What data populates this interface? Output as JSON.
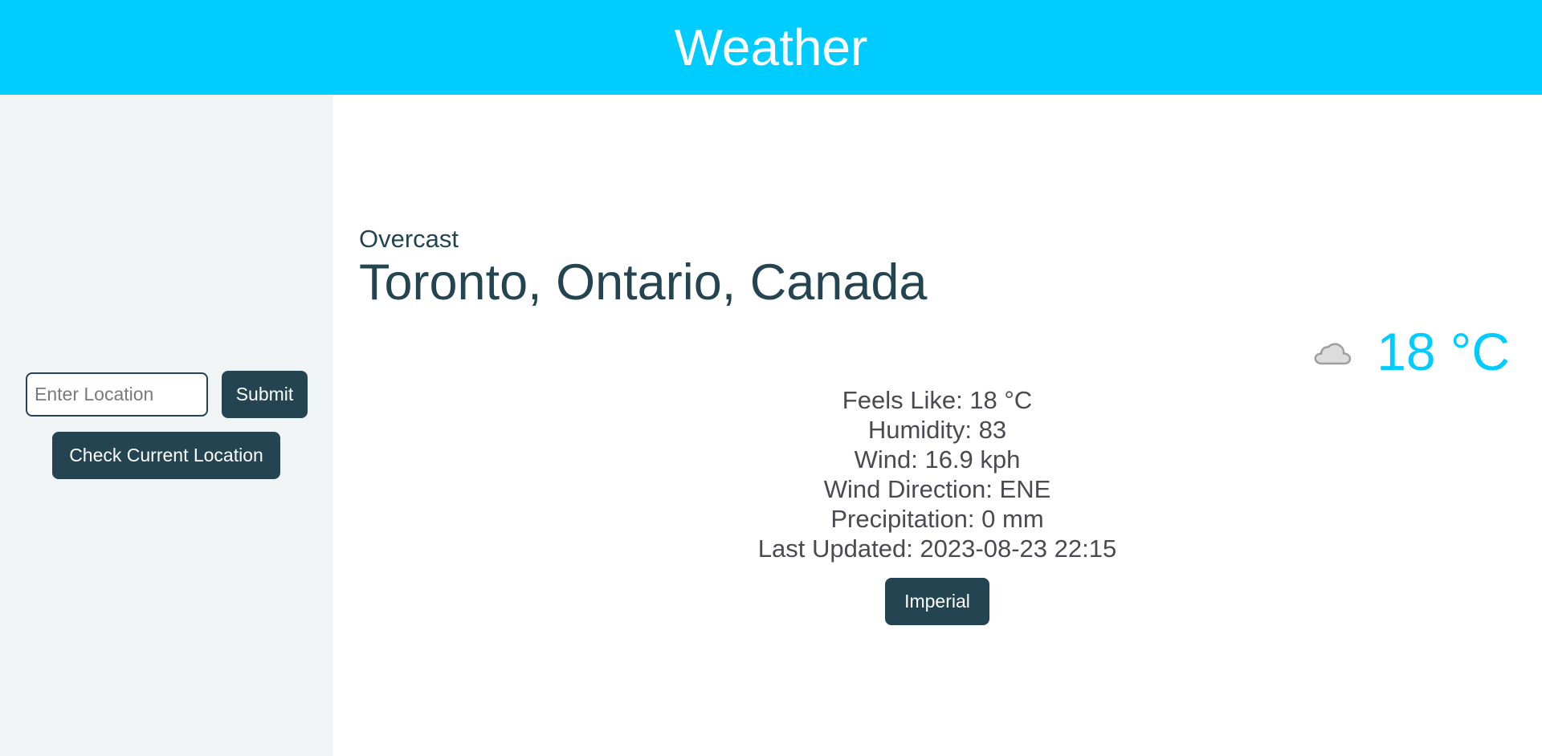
{
  "header": {
    "title": "Weather"
  },
  "sidebar": {
    "location_input": {
      "placeholder": "Enter Location",
      "value": ""
    },
    "submit_label": "Submit",
    "current_location_label": "Check Current Location"
  },
  "weather": {
    "condition": "Overcast",
    "location": "Toronto, Ontario, Canada",
    "temperature": "18 °C",
    "icon": "cloud-icon",
    "details": {
      "feels_like": "Feels Like: 18 °C",
      "humidity": "Humidity: 83",
      "wind": "Wind: 16.9 kph",
      "wind_direction": "Wind Direction: ENE",
      "precipitation": "Precipitation: 0 mm",
      "last_updated": "Last Updated: 2023-08-23 22:15"
    },
    "unit_toggle_label": "Imperial"
  },
  "colors": {
    "header_bg": "#00ccff",
    "sidebar_bg": "#f0f4f5",
    "button_bg": "#234450",
    "temperature": "#00ccff",
    "heading_text": "#234450"
  }
}
